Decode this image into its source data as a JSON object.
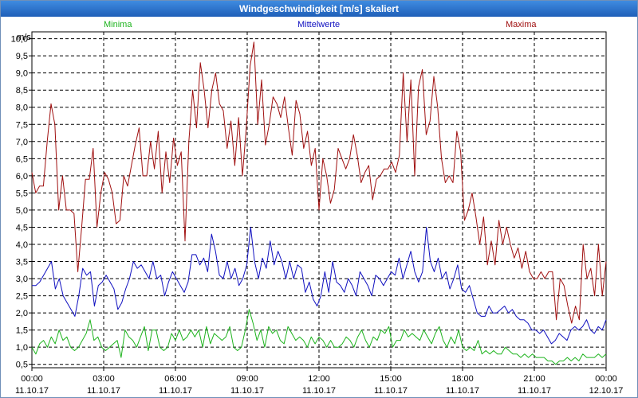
{
  "window": {
    "title": "Windgeschwindigkeit [m/s] skaliert"
  },
  "legend": {
    "min": "Minima",
    "avg": "Mittelwerte",
    "max": "Maxima"
  },
  "colors": {
    "min": "#1db31d",
    "avg": "#1010c0",
    "max": "#a01010",
    "grid": "#000000"
  },
  "chart_data": {
    "type": "line",
    "title": "Windgeschwindigkeit [m/s] skaliert",
    "ylabel": "m/s",
    "ylim": [
      0.4,
      10.2
    ],
    "xlim": [
      0,
      24
    ],
    "grid": true,
    "legend_position": "top",
    "yticks": [
      "0,5",
      "1,0",
      "1,5",
      "2,0",
      "2,5",
      "3,0",
      "3,5",
      "4,0",
      "4,5",
      "5,0",
      "5,5",
      "6,0",
      "6,5",
      "7,0",
      "7,5",
      "8,0",
      "8,5",
      "9,0",
      "9,5",
      "10,0"
    ],
    "xticks": [
      {
        "time": "00:00",
        "date": "11.10.17"
      },
      {
        "time": "03:00",
        "date": "11.10.17"
      },
      {
        "time": "06:00",
        "date": "11.10.17"
      },
      {
        "time": "09:00",
        "date": "11.10.17"
      },
      {
        "time": "12:00",
        "date": "11.10.17"
      },
      {
        "time": "15:00",
        "date": "11.10.17"
      },
      {
        "time": "18:00",
        "date": "11.10.17"
      },
      {
        "time": "21:00",
        "date": "11.10.17"
      },
      {
        "time": "00:00",
        "date": "12.10.17"
      }
    ],
    "series": [
      {
        "name": "Maxima",
        "key": "max",
        "values": [
          6.1,
          5.5,
          5.7,
          5.7,
          7.0,
          8.1,
          7.5,
          5.0,
          6.0,
          5.0,
          5.0,
          4.9,
          3.2,
          4.5,
          5.9,
          5.9,
          6.8,
          4.5,
          5.5,
          6.1,
          5.9,
          5.5,
          4.6,
          4.7,
          6.0,
          5.7,
          6.3,
          6.9,
          7.4,
          6.0,
          6.0,
          7.0,
          6.2,
          7.3,
          5.5,
          6.7,
          5.8,
          7.1,
          6.3,
          6.7,
          4.1,
          7.0,
          8.5,
          7.4,
          9.3,
          8.5,
          7.4,
          8.5,
          9.0,
          8.1,
          7.9,
          6.8,
          7.6,
          6.3,
          7.7,
          6.0,
          7.4,
          9.2,
          9.9,
          7.5,
          8.8,
          6.9,
          7.5,
          8.3,
          8.1,
          7.7,
          8.3,
          7.4,
          6.6,
          8.2,
          7.8,
          6.8,
          7.3,
          6.3,
          6.8,
          5.0,
          6.5,
          6.0,
          5.2,
          5.6,
          6.8,
          6.5,
          6.2,
          6.5,
          7.2,
          6.6,
          5.8,
          6.1,
          6.3,
          5.3,
          5.9,
          6.0,
          6.2,
          6.2,
          6.4,
          6.1,
          6.6,
          9.0,
          7.0,
          8.8,
          6.0,
          8.6,
          9.1,
          7.2,
          7.6,
          8.9,
          8.0,
          6.5,
          5.8,
          6.0,
          5.8,
          7.3,
          6.7,
          4.7,
          5.0,
          5.5,
          4.8,
          4.0,
          4.8,
          3.4,
          4.1,
          3.4,
          4.7,
          4.0,
          4.5,
          4.0,
          3.6,
          3.9,
          3.3,
          3.8,
          3.2,
          3.0,
          3.0,
          3.2,
          3.0,
          3.2,
          3.2,
          1.8,
          3.0,
          2.8,
          2.2,
          1.7,
          2.2,
          1.8,
          4.0,
          3.0,
          3.3,
          2.5,
          4.0,
          2.5,
          3.5
        ]
      },
      {
        "name": "Mittelwerte",
        "key": "avg",
        "values": [
          2.8,
          2.8,
          2.9,
          3.1,
          3.3,
          3.5,
          2.7,
          3.0,
          2.5,
          2.3,
          2.1,
          1.9,
          2.5,
          3.3,
          3.1,
          3.2,
          2.2,
          2.8,
          2.9,
          3.1,
          2.9,
          2.7,
          2.1,
          2.3,
          2.7,
          3.0,
          3.5,
          3.3,
          3.4,
          3.2,
          3.0,
          3.5,
          3.0,
          3.1,
          2.5,
          2.9,
          3.2,
          3.0,
          2.8,
          2.6,
          2.9,
          3.7,
          3.7,
          3.4,
          3.6,
          3.2,
          4.3,
          3.8,
          3.1,
          3.0,
          3.5,
          3.0,
          3.3,
          2.8,
          3.0,
          3.4,
          4.5,
          3.5,
          3.0,
          3.6,
          3.3,
          4.1,
          3.4,
          3.8,
          3.5,
          3.0,
          3.5,
          3.0,
          3.4,
          3.3,
          2.6,
          2.9,
          2.4,
          2.2,
          2.5,
          3.2,
          2.6,
          3.5,
          2.9,
          2.8,
          2.6,
          3.0,
          2.8,
          2.5,
          3.2,
          3.0,
          2.8,
          2.5,
          3.1,
          3.0,
          2.8,
          3.0,
          3.2,
          3.1,
          3.6,
          3.0,
          3.4,
          3.8,
          3.2,
          2.9,
          3.2,
          4.5,
          3.5,
          3.2,
          3.6,
          3.0,
          3.2,
          2.7,
          3.0,
          3.4,
          2.7,
          2.6,
          2.8,
          2.4,
          2.0,
          1.9,
          1.9,
          2.2,
          2.0,
          2.0,
          2.1,
          2.2,
          2.0,
          2.1,
          1.9,
          1.8,
          1.8,
          1.7,
          1.5,
          1.5,
          1.4,
          1.5,
          1.3,
          1.1,
          1.2,
          1.4,
          1.3,
          1.2,
          1.5,
          1.6,
          1.5,
          1.6,
          1.8,
          1.5,
          1.4,
          1.6,
          1.5,
          1.8
        ]
      },
      {
        "name": "Minima",
        "key": "min",
        "values": [
          1.0,
          0.8,
          1.1,
          1.2,
          1.0,
          1.3,
          1.1,
          1.5,
          1.2,
          1.3,
          1.0,
          0.9,
          1.0,
          1.2,
          1.4,
          1.8,
          1.2,
          1.3,
          1.0,
          0.9,
          1.0,
          1.1,
          1.2,
          0.7,
          1.5,
          1.3,
          1.2,
          1.0,
          1.3,
          1.6,
          0.9,
          1.5,
          1.5,
          1.0,
          0.9,
          1.0,
          1.4,
          1.2,
          1.5,
          1.2,
          1.3,
          1.5,
          1.3,
          1.5,
          1.0,
          1.6,
          1.1,
          1.4,
          1.3,
          1.2,
          1.3,
          1.6,
          1.0,
          0.9,
          1.0,
          1.5,
          2.1,
          1.7,
          1.2,
          1.5,
          1.0,
          1.6,
          1.4,
          1.5,
          1.2,
          1.1,
          1.6,
          1.4,
          1.2,
          1.3,
          1.2,
          1.0,
          1.3,
          1.1,
          1.3,
          1.2,
          1.0,
          1.2,
          1.0,
          1.0,
          1.1,
          1.3,
          1.2,
          1.0,
          1.3,
          1.5,
          1.2,
          1.0,
          1.3,
          1.2,
          1.5,
          1.4,
          1.6,
          1.0,
          1.2,
          1.2,
          1.5,
          1.3,
          1.4,
          1.3,
          1.2,
          1.5,
          1.3,
          1.1,
          1.4,
          1.6,
          1.2,
          1.0,
          1.3,
          1.1,
          1.5,
          1.0,
          0.9,
          1.0,
          0.9,
          1.2,
          0.8,
          0.9,
          0.8,
          0.9,
          0.8,
          0.8,
          1.0,
          0.9,
          0.8,
          0.8,
          0.7,
          0.8,
          0.7,
          0.8,
          0.7,
          0.7,
          0.7,
          0.6,
          0.6,
          0.5,
          0.6,
          0.6,
          0.7,
          0.6,
          0.7,
          0.6,
          0.8,
          0.7,
          0.7,
          0.7,
          0.8,
          0.7,
          0.8
        ]
      }
    ]
  }
}
